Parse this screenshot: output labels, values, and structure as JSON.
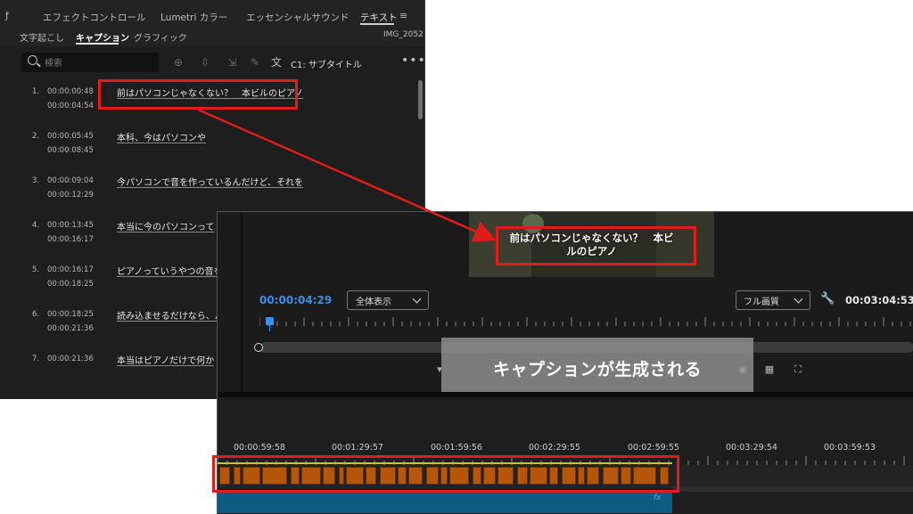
{
  "text_panel": {
    "tabs": [
      {
        "label": "ƒ"
      },
      {
        "label": "エフェクトコントロール"
      },
      {
        "label": "Lumetri カラー"
      },
      {
        "label": "エッセンシャルサウンド"
      },
      {
        "label": "テキスト"
      }
    ],
    "menu_glyph": "≡",
    "sub_tabs": [
      {
        "label": "文字起こし"
      },
      {
        "label": "キャプション"
      },
      {
        "label": "グラフィック"
      }
    ],
    "clip_name": "IMG_2052",
    "search": {
      "placeholder": "検索"
    },
    "track_label": "C1: サブタイトル",
    "more_glyph": "•••",
    "captions": [
      {
        "num": "1.",
        "in": "00:00:00:48",
        "out": "00:00:04:54",
        "text": "前はパソコンじゃなくない？　本ビルのピアノ"
      },
      {
        "num": "2.",
        "in": "00:00:05:45",
        "out": "00:00:08:45",
        "text": "本科、今はパソコンや"
      },
      {
        "num": "3.",
        "in": "00:00:09:04",
        "out": "00:00:12:29",
        "text": "今パソコンで音を作っているんだけど、それを"
      },
      {
        "num": "4.",
        "in": "00:00:13:45",
        "out": "00:00:16:17",
        "text": "本当に今のパソコンって"
      },
      {
        "num": "5.",
        "in": "00:00:16:17",
        "out": "00:00:18:25",
        "text": "ピアノっていうやつの音を"
      },
      {
        "num": "6.",
        "in": "00:00:18:25",
        "out": "00:00:21:36",
        "text": "読み込ませるだけなら、パソ"
      },
      {
        "num": "7.",
        "in": "00:00:21:36",
        "out": "",
        "text": "本当はピアノだけで何か"
      }
    ]
  },
  "monitor": {
    "subtitle_line1": "前はパソコンじゃなくない？　本ビ",
    "subtitle_line2": "ルのピアノ",
    "current_timecode": "00:00:04:29",
    "fit_select": "全体表示",
    "quality_select": "フル画質",
    "duration_timecode": "00:03:04:53",
    "overlay_text": "キャプションが生成される"
  },
  "timeline": {
    "time_labels": [
      "00:00:59:58",
      "00:01:29:57",
      "00:01:59:56",
      "00:02:29:55",
      "00:02:59:55",
      "00:03:29:54",
      "00:03:59:53"
    ],
    "fx_label": "fx"
  },
  "colors": {
    "annotation_red": "#e21b1b",
    "timecode_blue": "#3b8fe6",
    "clip_orange": "#b5560b",
    "track_teal": "#0d5d82"
  }
}
